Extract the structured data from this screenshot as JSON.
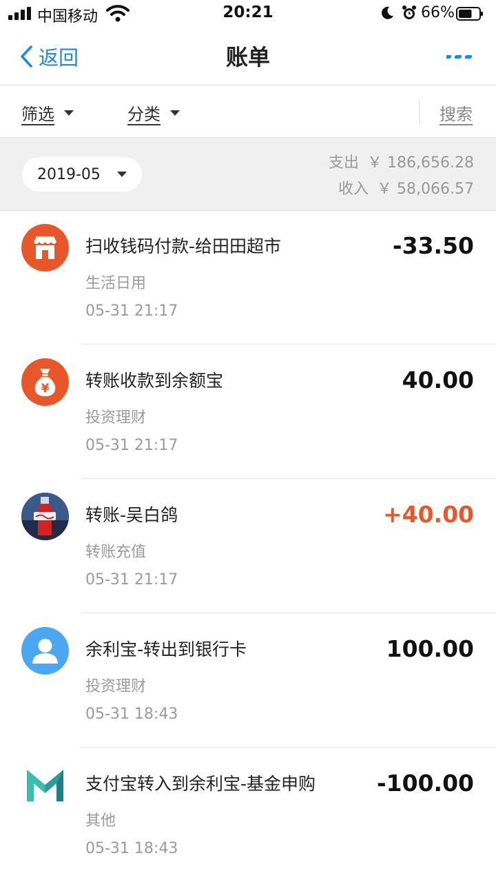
{
  "status_bar": {
    "carrier": "中国移动",
    "time": "20:21",
    "battery_percent": "66%",
    "battery_level": 0.66
  },
  "nav": {
    "back_label": "返回",
    "title": "账单",
    "more_icon": "more-dots-icon"
  },
  "filter_bar": {
    "filter_label": "筛选",
    "category_label": "分类",
    "search_label": "搜索"
  },
  "summary": {
    "month": "2019-05",
    "expense_label": "支出",
    "expense_value": "￥ 186,656.28",
    "income_label": "收入",
    "income_value": "￥ 58,066.57"
  },
  "colors": {
    "accent": "#1e88e5",
    "income": "#e55a2b",
    "merchant_icon_bg": "#e8572a",
    "user_icon_bg": "#4aa8f0"
  },
  "transactions": [
    {
      "icon": "store-icon",
      "name": "扫收钱码付款-给田田超市",
      "category": "生活日用",
      "time": "05-31  21:17",
      "amount": "-33.50",
      "type": "expense"
    },
    {
      "icon": "money-bag-icon",
      "name": "转账收款到余额宝",
      "category": "投资理财",
      "time": "05-31  21:17",
      "amount": "40.00",
      "type": "neutral"
    },
    {
      "icon": "user-photo-avatar",
      "name": "转账-吴白鸽",
      "category": "转账充值",
      "time": "05-31  21:17",
      "amount": "+40.00",
      "type": "income"
    },
    {
      "icon": "default-user-icon",
      "name": "余利宝-转出到银行卡",
      "category": "投资理财",
      "time": "05-31  18:43",
      "amount": "100.00",
      "type": "neutral"
    },
    {
      "icon": "m-logo-icon",
      "name": "支付宝转入到余利宝-基金申购",
      "category": "其他",
      "time": "05-31  18:43",
      "amount": "-100.00",
      "type": "expense"
    }
  ]
}
